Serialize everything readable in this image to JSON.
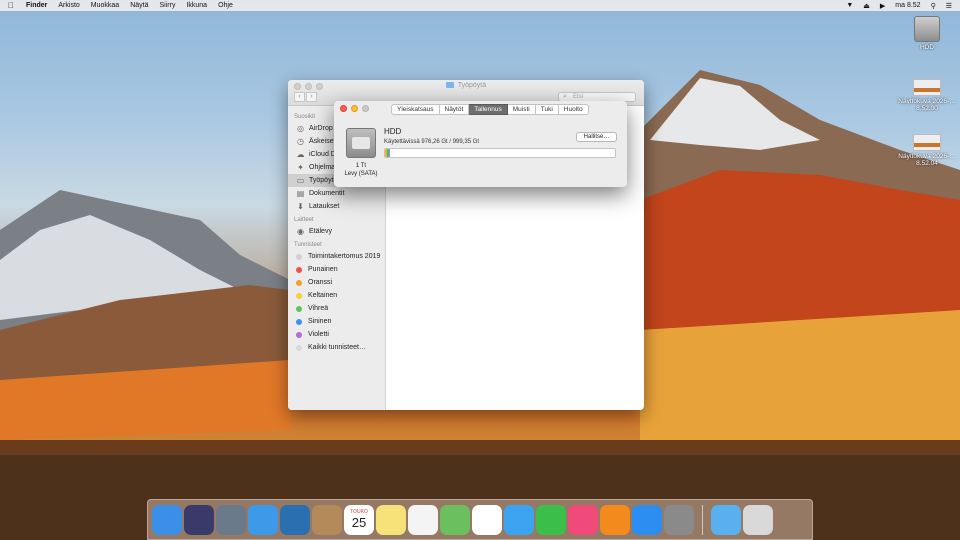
{
  "menubar": {
    "app": "Finder",
    "items": [
      "Arkisto",
      "Muokkaa",
      "Näytä",
      "Siirry",
      "Ikkuna",
      "Ohje"
    ],
    "clock": "ma 8.52"
  },
  "desktop_icons": [
    {
      "label": "HDD",
      "icon": "hard-drive-icon"
    },
    {
      "label": "Näyttökuva 2026-…8.52.00",
      "icon": "screenshot-icon"
    },
    {
      "label": "Näyttökuva 2026-…8.52.04",
      "icon": "screenshot-icon"
    }
  ],
  "finder": {
    "title": "Työpöytä",
    "search_placeholder": "Etsi",
    "sidebar": {
      "sections": [
        {
          "head": "Suosikit",
          "items": [
            {
              "label": "AirDrop",
              "icon": "airdrop-icon"
            },
            {
              "label": "Äskeiset",
              "icon": "recents-icon"
            },
            {
              "label": "iCloud Drive",
              "icon": "icloud-icon"
            },
            {
              "label": "Ohjelmat",
              "icon": "applications-icon"
            },
            {
              "label": "Työpöytä",
              "icon": "desktop-icon",
              "selected": true
            },
            {
              "label": "Dokumentit",
              "icon": "documents-icon"
            },
            {
              "label": "Lataukset",
              "icon": "downloads-icon"
            }
          ]
        },
        {
          "head": "Laitteet",
          "items": [
            {
              "label": "Etälevy",
              "icon": "remote-disc-icon"
            }
          ]
        },
        {
          "head": "Tunnisteet",
          "items": [
            {
              "label": "Toimintakertomus 2019",
              "color": "#d0d0d0"
            },
            {
              "label": "Punainen",
              "color": "#f0524a"
            },
            {
              "label": "Oranssi",
              "color": "#f5a02b"
            },
            {
              "label": "Keltainen",
              "color": "#f5d33a"
            },
            {
              "label": "Vihreä",
              "color": "#5bc65a"
            },
            {
              "label": "Sininen",
              "color": "#3e8ff0"
            },
            {
              "label": "Violetti",
              "color": "#b26ad8"
            },
            {
              "label": "Kaikki tunnisteet…",
              "color": "#d8d8d8"
            }
          ]
        }
      ]
    }
  },
  "panel": {
    "tabs": [
      "Yleiskatsaus",
      "Näytöt",
      "Tallennus",
      "Muisti",
      "Tuki",
      "Huolto"
    ],
    "active_tab": "Tallennus",
    "disk_size": "1 Tt",
    "disk_type": "Levy (SATA)",
    "disk_name": "HDD",
    "available": "Käytettävissä 976,26 Gt / 999,35 Gt",
    "used_fraction": 0.023,
    "manage_button": "Hallitse…"
  },
  "dock": [
    {
      "name": "finder-icon",
      "bg": "#3b8fe8"
    },
    {
      "name": "siri-icon",
      "bg": "#3a3a6a"
    },
    {
      "name": "launchpad-icon",
      "bg": "#6b7a8a"
    },
    {
      "name": "safari-icon",
      "bg": "#3c9ae8"
    },
    {
      "name": "photo-app-icon",
      "bg": "#2a6fb0"
    },
    {
      "name": "contacts-icon",
      "bg": "#b48a5a"
    },
    {
      "name": "calendar-icon",
      "bg": "#ffffff",
      "text": "25",
      "month": "TOUKO"
    },
    {
      "name": "notes-icon",
      "bg": "#f7e27a"
    },
    {
      "name": "reminders-icon",
      "bg": "#f4f4f4"
    },
    {
      "name": "maps-icon",
      "bg": "#6bbf5e"
    },
    {
      "name": "photos-icon",
      "bg": "#ffffff"
    },
    {
      "name": "messages-icon",
      "bg": "#3ba3f0"
    },
    {
      "name": "facetime-icon",
      "bg": "#3bbf4a"
    },
    {
      "name": "itunes-icon",
      "bg": "#f04a7a"
    },
    {
      "name": "ibooks-icon",
      "bg": "#f28a1e"
    },
    {
      "name": "app-store-icon",
      "bg": "#2b8ef0"
    },
    {
      "name": "system-preferences-icon",
      "bg": "#8a8a8a"
    },
    {
      "name": "downloads-folder-icon",
      "bg": "#5ab0ee",
      "after_sep": true
    },
    {
      "name": "trash-icon",
      "bg": "#d9d9d9"
    }
  ]
}
